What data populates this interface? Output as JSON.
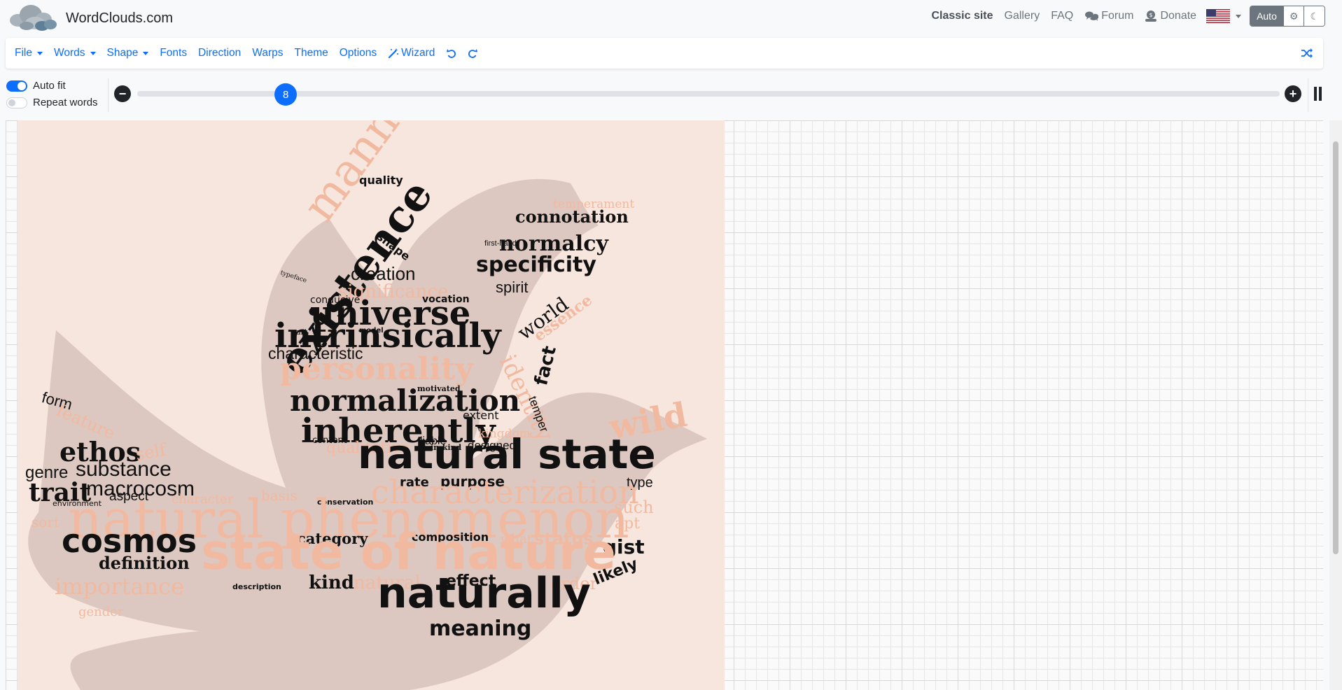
{
  "brand": {
    "title": "WordClouds.com",
    "logo_icon": "cloud-logo-icon"
  },
  "topnav": {
    "classic": "Classic site",
    "gallery": "Gallery",
    "faq": "FAQ",
    "forum": "Forum",
    "donate": "Donate",
    "flag_icon": "us-flag-icon",
    "theme_auto": "Auto"
  },
  "toolbar": {
    "file": "File",
    "words": "Words",
    "shape": "Shape",
    "fonts": "Fonts",
    "direction": "Direction",
    "warps": "Warps",
    "theme": "Theme",
    "options": "Options",
    "wizard": "Wizard"
  },
  "controls": {
    "auto_fit": "Auto fit",
    "auto_fit_on": true,
    "repeat_words": "Repeat words",
    "repeat_words_on": false,
    "slider_value": "8",
    "slider_fraction": 0.13
  },
  "colors": {
    "accent": "#0d6efd",
    "cloud_bg": "#f7e6dd",
    "shape_fill": "#dcc8c0",
    "salmon": "#f1b9a0",
    "ink": "#111111"
  },
  "cloud": {
    "words": [
      "manner",
      "quality",
      "existence",
      "shape",
      "creation",
      "typeface",
      "temperament",
      "connotation",
      "normalcy",
      "first-hand",
      "specificity",
      "spirit",
      "world",
      "essence",
      "fact",
      "significance",
      "conducive",
      "vocation",
      "universe",
      "art",
      "model",
      "intrinsically",
      "characteristic",
      "personality",
      "identity",
      "motivated",
      "normalization",
      "temper",
      "extent",
      "inherently",
      "form",
      "feature",
      "content",
      "liable",
      "designed",
      "in-kind",
      "qualitative",
      "kingdom",
      "wild",
      "ethos",
      "self",
      "genre",
      "substance",
      "natural state",
      "trait",
      "macrocosm",
      "rate",
      "purpose",
      "type",
      "aspect",
      "character",
      "basis",
      "environment",
      "conservation",
      "characterization",
      "such",
      "sort",
      "natural phenomenon",
      "apt",
      "cosmos",
      "category",
      "composition",
      "what",
      "status",
      "gist",
      "definition",
      "state of nature",
      "importance",
      "description",
      "kind",
      "natural",
      "effect",
      "order",
      "likely",
      "naturally",
      "gender",
      "meaning"
    ]
  }
}
